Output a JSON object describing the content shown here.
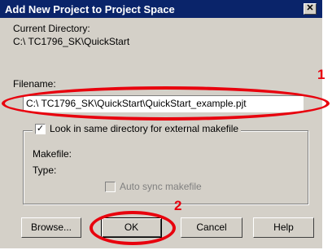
{
  "dialog": {
    "title": "Add New Project to Project Space",
    "close_glyph": "✕",
    "current_dir_label": "Current Directory:",
    "current_dir_value": "C:\\ TC1796_SK\\QuickStart",
    "filename_label": "Filename:",
    "filename_value": "C:\\ TC1796_SK\\QuickStart\\QuickStart_example.pjt",
    "look_same_dir_label": "Look in same directory for external makefile",
    "look_same_dir_checked": "✓",
    "makefile_label": "Makefile:",
    "type_label": "Type:",
    "auto_sync_label": "Auto sync makefile",
    "buttons": {
      "browse": "Browse...",
      "ok": "OK",
      "cancel": "Cancel",
      "help": "Help"
    }
  },
  "annotations": {
    "marker1": "1",
    "marker2": "2",
    "color": "#e8000d"
  }
}
